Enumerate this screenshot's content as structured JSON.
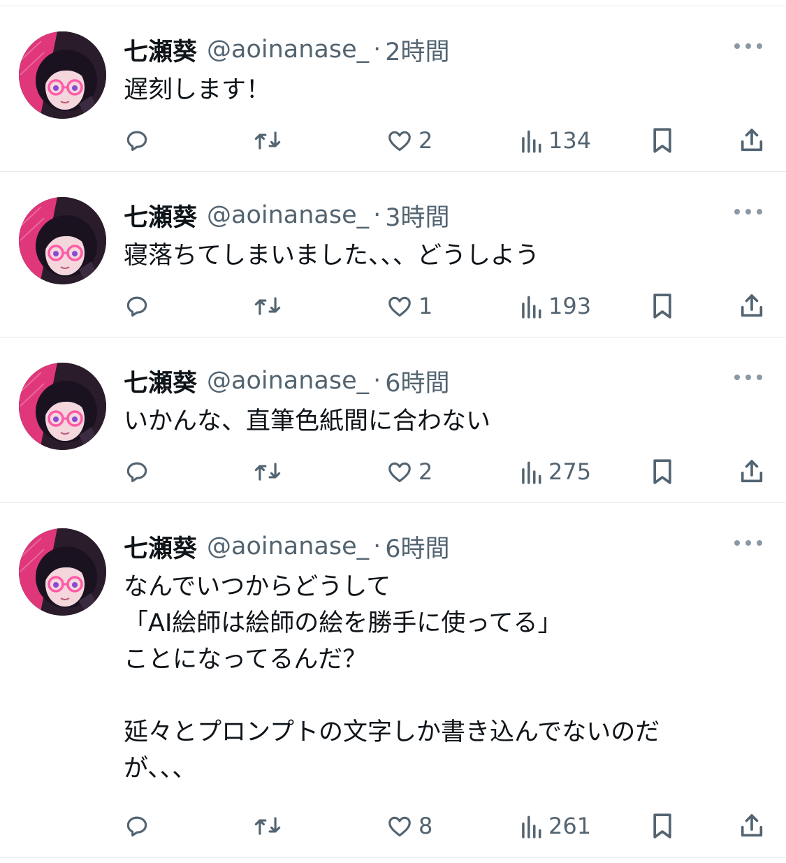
{
  "tweets": [
    {
      "name": "七瀬葵",
      "handle": "@aoinanase_",
      "sep": "·",
      "time": "2時間",
      "text": "遅刻します！",
      "likes": "2",
      "views": "134"
    },
    {
      "name": "七瀬葵",
      "handle": "@aoinanase_",
      "sep": "·",
      "time": "3時間",
      "text": "寝落ちてしまいました、、、どうしよう",
      "likes": "1",
      "views": "193"
    },
    {
      "name": "七瀬葵",
      "handle": "@aoinanase_",
      "sep": "·",
      "time": "6時間",
      "text": "いかんな、直筆色紙間に合わない",
      "likes": "2",
      "views": "275"
    },
    {
      "name": "七瀬葵",
      "handle": "@aoinanase_",
      "sep": "·",
      "time": "6時間",
      "text": "なんでいつからどうして\n「AI絵師は絵師の絵を勝手に使ってる」\nことになってるんだ？\n\n延々とプロンプトの文字しか書き込んでないのだ\nが、、、",
      "likes": "8",
      "views": "261"
    }
  ],
  "icons": [
    "avatar",
    "more-icon",
    "reply-icon",
    "retweet-icon",
    "like-icon",
    "views-icon",
    "bookmark-icon",
    "share-icon"
  ],
  "colors": {
    "text": "#0f1419",
    "secondary": "#536471",
    "divider": "#e7e9ea",
    "avatar_accent": "#e0367a"
  }
}
